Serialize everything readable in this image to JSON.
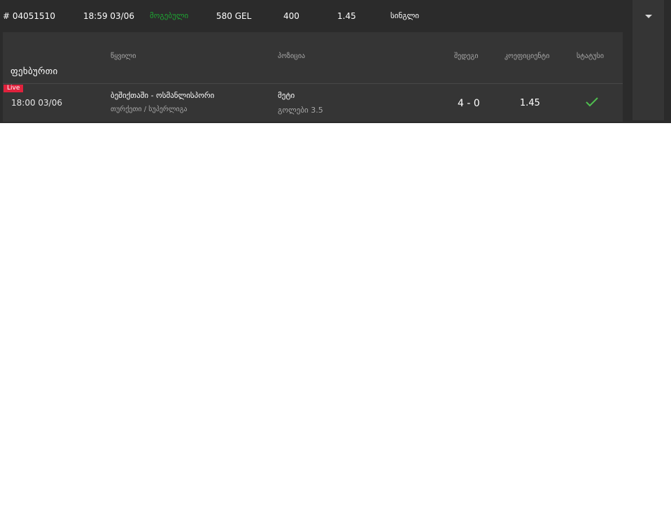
{
  "summary": {
    "bet_id": "# 04051510",
    "datetime": "18:59 03/06",
    "status": "მოგებული",
    "stake": "580 GEL",
    "odds_total": "400",
    "coefficient": "1.45",
    "bet_type": "სინგლი"
  },
  "details": {
    "sport": "ფეხბურთი",
    "headers": {
      "event": "წყვილი",
      "position": "პოზიცია",
      "score": "შედეგი",
      "coefficient": "კოეფიციენტი",
      "status": "სტატუსი"
    },
    "rows": [
      {
        "live_badge": "Live",
        "time": "18:00 03/06",
        "event": "ბეშიქთაში - ოსმანლისპორი",
        "league": "თურქეთი / სუპერლიგა",
        "position": "მეტი",
        "position_detail": "გოლები 3.5",
        "score": "4 - 0",
        "coefficient": "1.45",
        "status_icon": "check-icon"
      }
    ]
  },
  "colors": {
    "panel_bg": "#2b2b2b",
    "card_bg": "#353535",
    "win_green": "#1fa533",
    "live_red": "#e0223d",
    "check_green": "#4fbf4f"
  },
  "icons": {
    "expand": "chevron-down-icon",
    "status": "check-icon"
  }
}
